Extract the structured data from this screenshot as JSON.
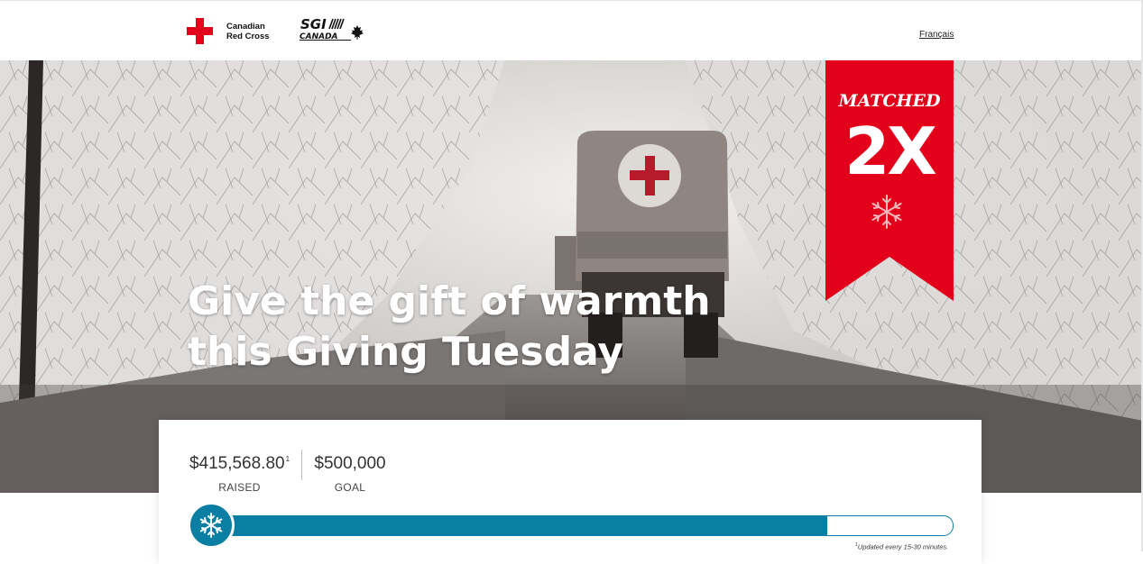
{
  "header": {
    "org_name_line1": "Canadian",
    "org_name_line2": "Red Cross",
    "partner_logo_text_1": "SGI",
    "partner_logo_text_2": "CANADA",
    "language_link": "Français"
  },
  "hero": {
    "title_line1": "Give the gift of warmth",
    "title_line2": "this Giving Tuesday",
    "ribbon_top": "MATCHED",
    "ribbon_main": "2X"
  },
  "campaign": {
    "raised_amount": "$415,568.80",
    "raised_footnote": "1",
    "raised_label": "RAISED",
    "goal_amount": "$500,000",
    "goal_label": "GOAL",
    "progress_fraction": 0.831,
    "update_footnote": "1",
    "update_note": "Updated every 15-30 minutes."
  },
  "colors": {
    "brand_red": "#e3001b",
    "progress_blue": "#0b7fa3"
  },
  "icons": [
    "red-cross-icon",
    "maple-leaf-icon",
    "snowflake-icon"
  ]
}
